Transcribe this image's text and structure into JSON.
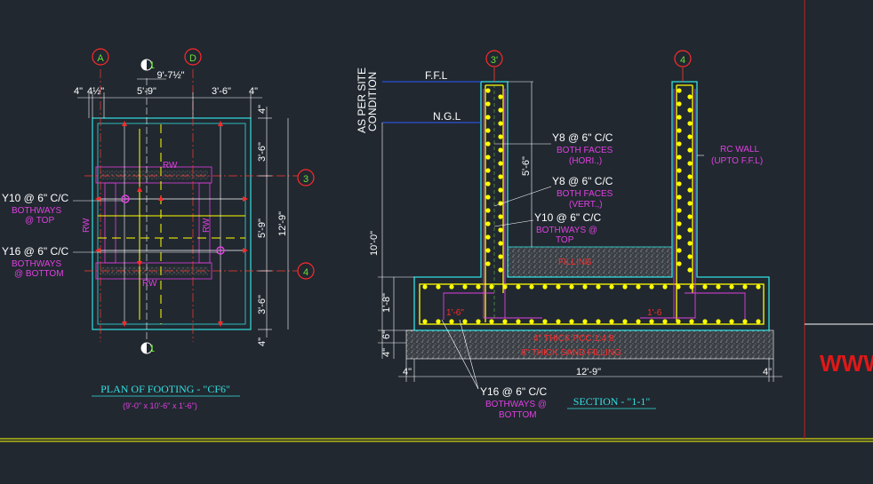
{
  "colors": {
    "background": "#212830",
    "concrete": "#34e0e0",
    "dimension": "#ffffff",
    "text_label": "#ffffff",
    "annotation": "#e040e0",
    "rebar": "#ffff00",
    "gridline": "#ff3b30",
    "marker": "#ff2a2a",
    "green_dim": "#6ddc3c"
  },
  "plan": {
    "grid_a": "A",
    "grid_d": "D",
    "grid_3": "3",
    "grid_4": "4",
    "sec_top": "1",
    "sec_bot": "1",
    "dim_total_width": "9'-7½\"",
    "dim_left_offset": "4\"",
    "dim_left_offset2": "4½\"",
    "dim_mid": "5'-9\"",
    "dim_right": "3'-6\"",
    "dim_right_offset": "4\"",
    "dim_top_right": "4\"",
    "dim_v1": "3'-6\"",
    "dim_v2": "5'-9\"",
    "dim_v3": "3'-6\"",
    "dim_v_total": "12'-9\"",
    "dim_bottom_right": "4\"",
    "rw_top": "RW",
    "rw_bot": "RW",
    "rw_left": "RW",
    "rw_right": "RW",
    "bar_top_label": "Y10 @ 6\" C/C",
    "bar_top_note1": "BOTHWAYS",
    "bar_top_note2": "@ TOP",
    "bar_bot_label": "Y16 @ 6\" C/C",
    "bar_bot_note1": "BOTHWAYS",
    "bar_bot_note2": "@ BOTTOM",
    "title": "PLAN OF FOOTING - \"CF6\"",
    "subtitle": "(9'-0\" x 10'-6\" x 1'-6\")"
  },
  "section": {
    "grid_3": "3'",
    "grid_4": "4",
    "ffl": "F.F.L",
    "ngl": "N.G.L",
    "as_per_site_1": "AS PER SITE",
    "as_per_site_2": "CONDITION",
    "y8_hori_label": "Y8 @ 6\" C/C",
    "y8_hori_note1": "BOTH FACES",
    "y8_hori_note2": "(HORI.,)",
    "y8_vert_label": "Y8 @ 6\" C/C",
    "y8_vert_note1": "BOTH FACES",
    "y8_vert_note2": "(VERT.,)",
    "y10_label": "Y10 @ 6\" C/C",
    "y10_note1": "BOTHWAYS @",
    "y10_note2": "TOP",
    "rc_wall_1": "RC WALL",
    "rc_wall_2": "(UPTO F.F.L)",
    "filling": "FILLING",
    "dim_5_6": "5'-6\"",
    "dim_10_0": "10'-0\"",
    "dim_1_8": "1'-8\"",
    "dim_6": "6\"",
    "dim_4": "4\"",
    "lap_left": "1'-6\"",
    "lap_right": "1'-6",
    "pcc": "4\" THICK PCC 1:4:8",
    "sand": "6\" THICK SAND FILLING",
    "dim_width": "12'-9\"",
    "dim_left_4": "4\"",
    "dim_right_4": "4\"",
    "y16_label": "Y16 @ 6\" C/C",
    "y16_note1": "BOTHWAYS @",
    "y16_note2": "BOTTOM",
    "title": "SECTION - \"1-1\""
  },
  "watermark": "WWW"
}
